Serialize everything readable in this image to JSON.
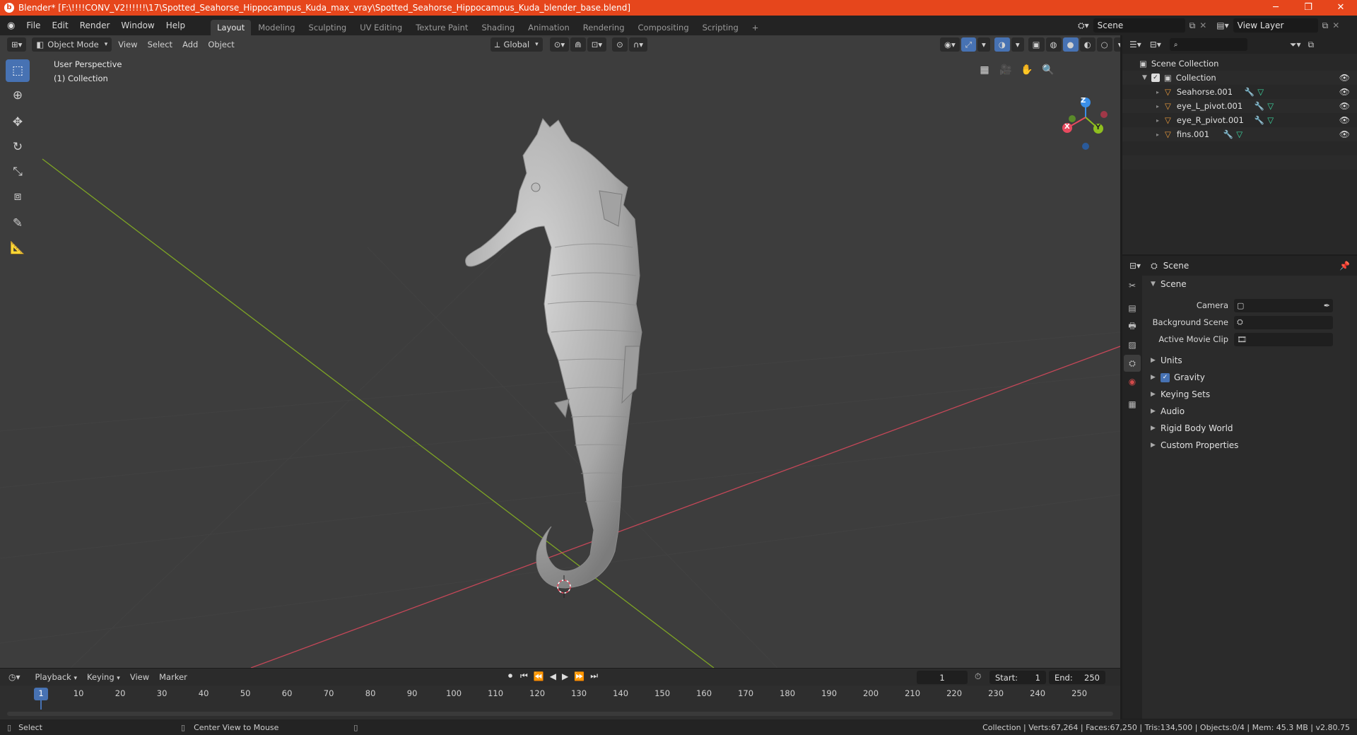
{
  "window": {
    "title": "Blender* [F:\\!!!!CONV_V2!!!!!!\\17\\Spotted_Seahorse_Hippocampus_Kuda_max_vray\\Spotted_Seahorse_Hippocampus_Kuda_blender_base.blend]",
    "logo": "blender-logo-icon"
  },
  "menubar": {
    "items": [
      "File",
      "Edit",
      "Render",
      "Window",
      "Help"
    ]
  },
  "workspaces": [
    "Layout",
    "Modeling",
    "Sculpting",
    "UV Editing",
    "Texture Paint",
    "Shading",
    "Animation",
    "Rendering",
    "Compositing",
    "Scripting",
    "+"
  ],
  "scene_selector": {
    "value": "Scene"
  },
  "viewlayer_selector": {
    "value": "View Layer"
  },
  "viewport": {
    "mode": "Object Mode",
    "menus": [
      "View",
      "Select",
      "Add",
      "Object"
    ],
    "transform_orientation": "Global",
    "perspective_label": "User Perspective",
    "collection_label": "(1) Collection",
    "gizmo": {
      "x": "X",
      "y": "Y",
      "z": "Z"
    }
  },
  "outliner": {
    "search_placeholder": "",
    "scene_collection": "Scene Collection",
    "collection": "Collection",
    "objects": [
      "Seahorse.001",
      "eye_L_pivot.001",
      "eye_R_pivot.001",
      "fins.001"
    ]
  },
  "properties": {
    "header": "Scene",
    "panel_title": "Scene",
    "fields": [
      {
        "label": "Camera",
        "value": ""
      },
      {
        "label": "Background Scene",
        "value": ""
      },
      {
        "label": "Active Movie Clip",
        "value": ""
      }
    ],
    "sections": [
      "Units",
      "Gravity",
      "Keying Sets",
      "Audio",
      "Rigid Body World",
      "Custom Properties"
    ],
    "gravity_checked": true
  },
  "timeline": {
    "menus": [
      "Playback",
      "Keying",
      "View",
      "Marker"
    ],
    "current_frame": "1",
    "start_label": "Start:",
    "start": "1",
    "end_label": "End:",
    "end": "250",
    "frame_numbers": [
      "1",
      "10",
      "20",
      "30",
      "40",
      "50",
      "60",
      "70",
      "80",
      "90",
      "100",
      "110",
      "120",
      "130",
      "140",
      "150",
      "160",
      "170",
      "180",
      "190",
      "200",
      "210",
      "220",
      "230",
      "240",
      "250"
    ]
  },
  "statusbar": {
    "left_action": "Select",
    "middle_action": "Center View to Mouse",
    "stats": "Collection | Verts:67,264 | Faces:67,250 | Tris:134,500 | Objects:0/4 | Mem: 45.3 MB | v2.80.75"
  },
  "colors": {
    "titlebar": "#e6461c",
    "accent": "#4772b3",
    "x_axis": "#e84a5f",
    "y_axis": "#8fbf1f",
    "z_axis": "#3a8fe8"
  }
}
